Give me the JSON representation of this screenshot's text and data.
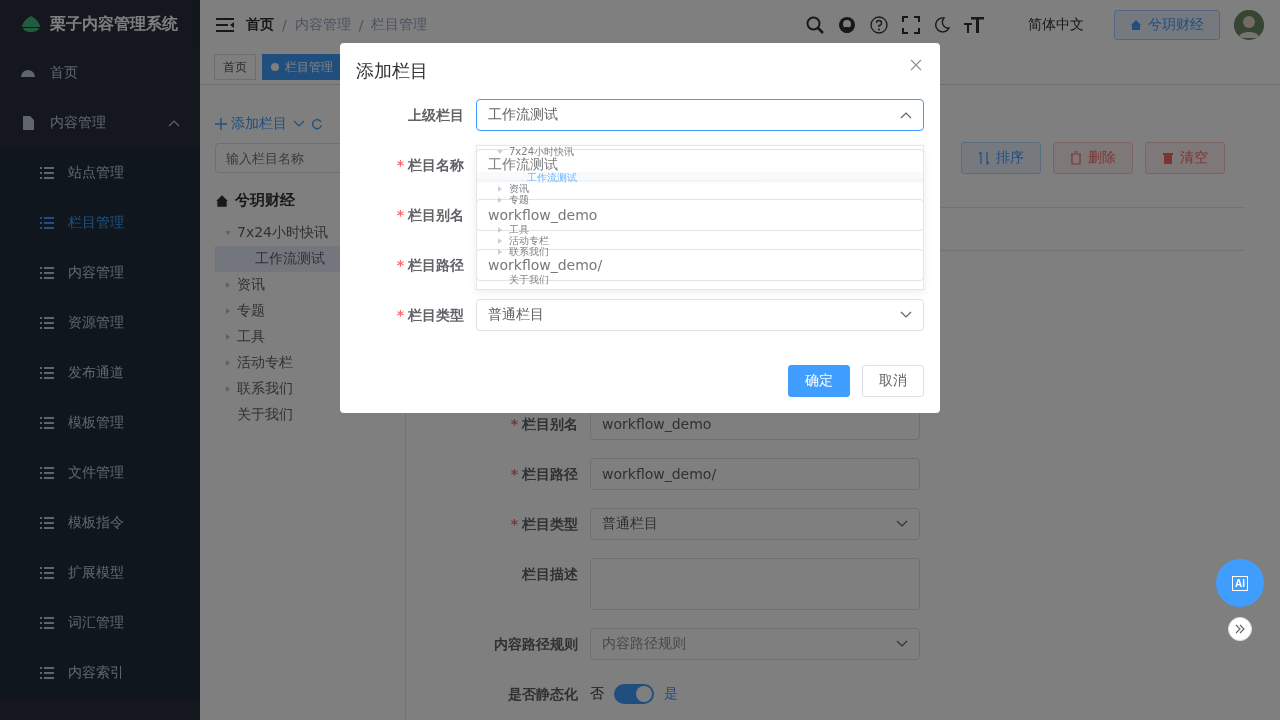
{
  "app": {
    "title": "栗子内容管理系统"
  },
  "required_mark": "*",
  "sidebar": {
    "items": [
      {
        "label": "首页",
        "selected": false
      },
      {
        "label": "内容管理",
        "expanded": true,
        "selected": false,
        "children": [
          {
            "label": "站点管理",
            "selected": false
          },
          {
            "label": "栏目管理",
            "selected": true
          },
          {
            "label": "内容管理",
            "selected": false
          },
          {
            "label": "资源管理",
            "selected": false
          },
          {
            "label": "发布通道",
            "selected": false
          },
          {
            "label": "模板管理",
            "selected": false
          },
          {
            "label": "文件管理",
            "selected": false
          },
          {
            "label": "模板指令",
            "selected": false
          },
          {
            "label": "扩展模型",
            "selected": false
          },
          {
            "label": "词汇管理",
            "selected": false
          },
          {
            "label": "内容索引",
            "selected": false
          }
        ]
      }
    ]
  },
  "header": {
    "breadcrumb": [
      "首页",
      "内容管理",
      "栏目管理"
    ],
    "separator": "/",
    "language": "简体中文",
    "site_button": "兮玥财经"
  },
  "tags": [
    {
      "label": "首页",
      "selected": false
    },
    {
      "label": "栏目管理",
      "selected": true
    }
  ],
  "catalog": {
    "add_button": "添加栏目",
    "search": {
      "placeholder": "输入栏目名称"
    },
    "root": "兮玥财经",
    "tree": [
      {
        "label": "7x24小时快讯",
        "expanded": true,
        "selected": false,
        "children": [
          {
            "label": "工作流测试",
            "selected": true
          }
        ]
      },
      {
        "label": "资讯",
        "expanded": false,
        "selected": false
      },
      {
        "label": "专题",
        "expanded": false,
        "selected": false
      },
      {
        "label": "工具",
        "expanded": false,
        "selected": false
      },
      {
        "label": "活动专栏",
        "expanded": false,
        "selected": false
      },
      {
        "label": "联系我们",
        "expanded": false,
        "selected": false
      },
      {
        "label": "关于我们",
        "selected": false
      }
    ]
  },
  "toolbar": [
    {
      "label": "排序",
      "kind": "sort"
    },
    {
      "label": "删除",
      "kind": "delete"
    },
    {
      "label": "清空",
      "kind": "clear"
    }
  ],
  "form": {
    "fields": [
      {
        "label": "栏目别名",
        "required": true,
        "kind": "input",
        "value": "workflow_demo"
      },
      {
        "label": "栏目路径",
        "required": true,
        "kind": "input",
        "value": "workflow_demo/"
      },
      {
        "label": "栏目类型",
        "required": true,
        "kind": "select",
        "value": "普通栏目"
      },
      {
        "label": "栏目描述",
        "required": false,
        "kind": "textarea"
      },
      {
        "label": "内容路径规则",
        "required": false,
        "kind": "select",
        "placeholder": "内容路径规则"
      },
      {
        "label": "是否静态化",
        "required": false,
        "kind": "switch",
        "off_label": "否",
        "on_label": "是",
        "on": true
      }
    ]
  },
  "dialog": {
    "title": "添加栏目",
    "fields": [
      {
        "label": "上级栏目",
        "required": false,
        "kind": "tree-select",
        "value": "工作流测试",
        "open": true
      },
      {
        "label": "栏目名称",
        "required": true,
        "kind": "input",
        "value": "工作流测试"
      },
      {
        "label": "栏目别名",
        "required": true,
        "kind": "input",
        "value": "workflow_demo"
      },
      {
        "label": "栏目路径",
        "required": true,
        "kind": "input",
        "value": "workflow_demo/"
      },
      {
        "label": "栏目类型",
        "required": true,
        "kind": "select",
        "value": "普通栏目"
      }
    ],
    "dropdown": [
      {
        "label": "7x24小时快讯",
        "expanded": true,
        "selected": false,
        "children": [
          {
            "label": "工作流测试",
            "selected": true
          }
        ]
      },
      {
        "label": "资讯",
        "expanded": false,
        "selected": false
      },
      {
        "label": "专题",
        "expanded": false,
        "selected": false
      },
      {
        "label": "工具",
        "expanded": false,
        "selected": false
      },
      {
        "label": "活动专栏",
        "expanded": false,
        "selected": false
      },
      {
        "label": "联系我们",
        "expanded": false,
        "selected": false
      },
      {
        "label": "关于我们",
        "selected": false
      }
    ],
    "buttons": [
      {
        "label": "确定",
        "kind": "primary"
      },
      {
        "label": "取消",
        "kind": "default"
      }
    ]
  },
  "ai_button": "AI"
}
